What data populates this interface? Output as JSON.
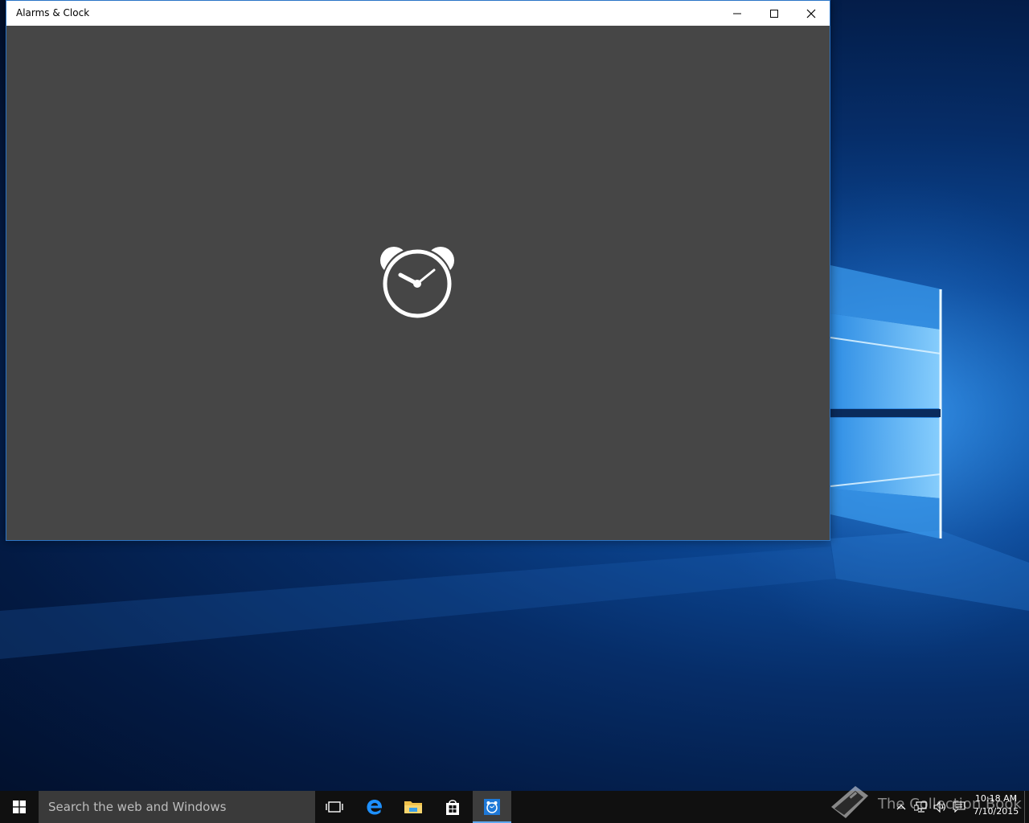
{
  "window": {
    "title": "Alarms & Clock",
    "controls": {
      "minimize": "minimize-icon",
      "maximize": "maximize-icon",
      "close": "close-icon"
    },
    "content_background": "#464646",
    "splash_icon": "alarm-clock-icon"
  },
  "taskbar": {
    "search": {
      "placeholder": "Search the web and Windows"
    },
    "pinned": [
      {
        "name": "task-view",
        "icon": "task-view-icon"
      },
      {
        "name": "edge",
        "icon": "edge-icon"
      },
      {
        "name": "file-explorer",
        "icon": "folder-icon"
      },
      {
        "name": "store",
        "icon": "store-icon"
      },
      {
        "name": "alarms-clock",
        "icon": "alarm-clock-icon",
        "active": true
      }
    ],
    "accent": "#5fa8f0"
  },
  "watermark": {
    "text": "The Collection Book"
  },
  "tray": {
    "time": "10:18 AM",
    "date": "7/10/2015"
  }
}
